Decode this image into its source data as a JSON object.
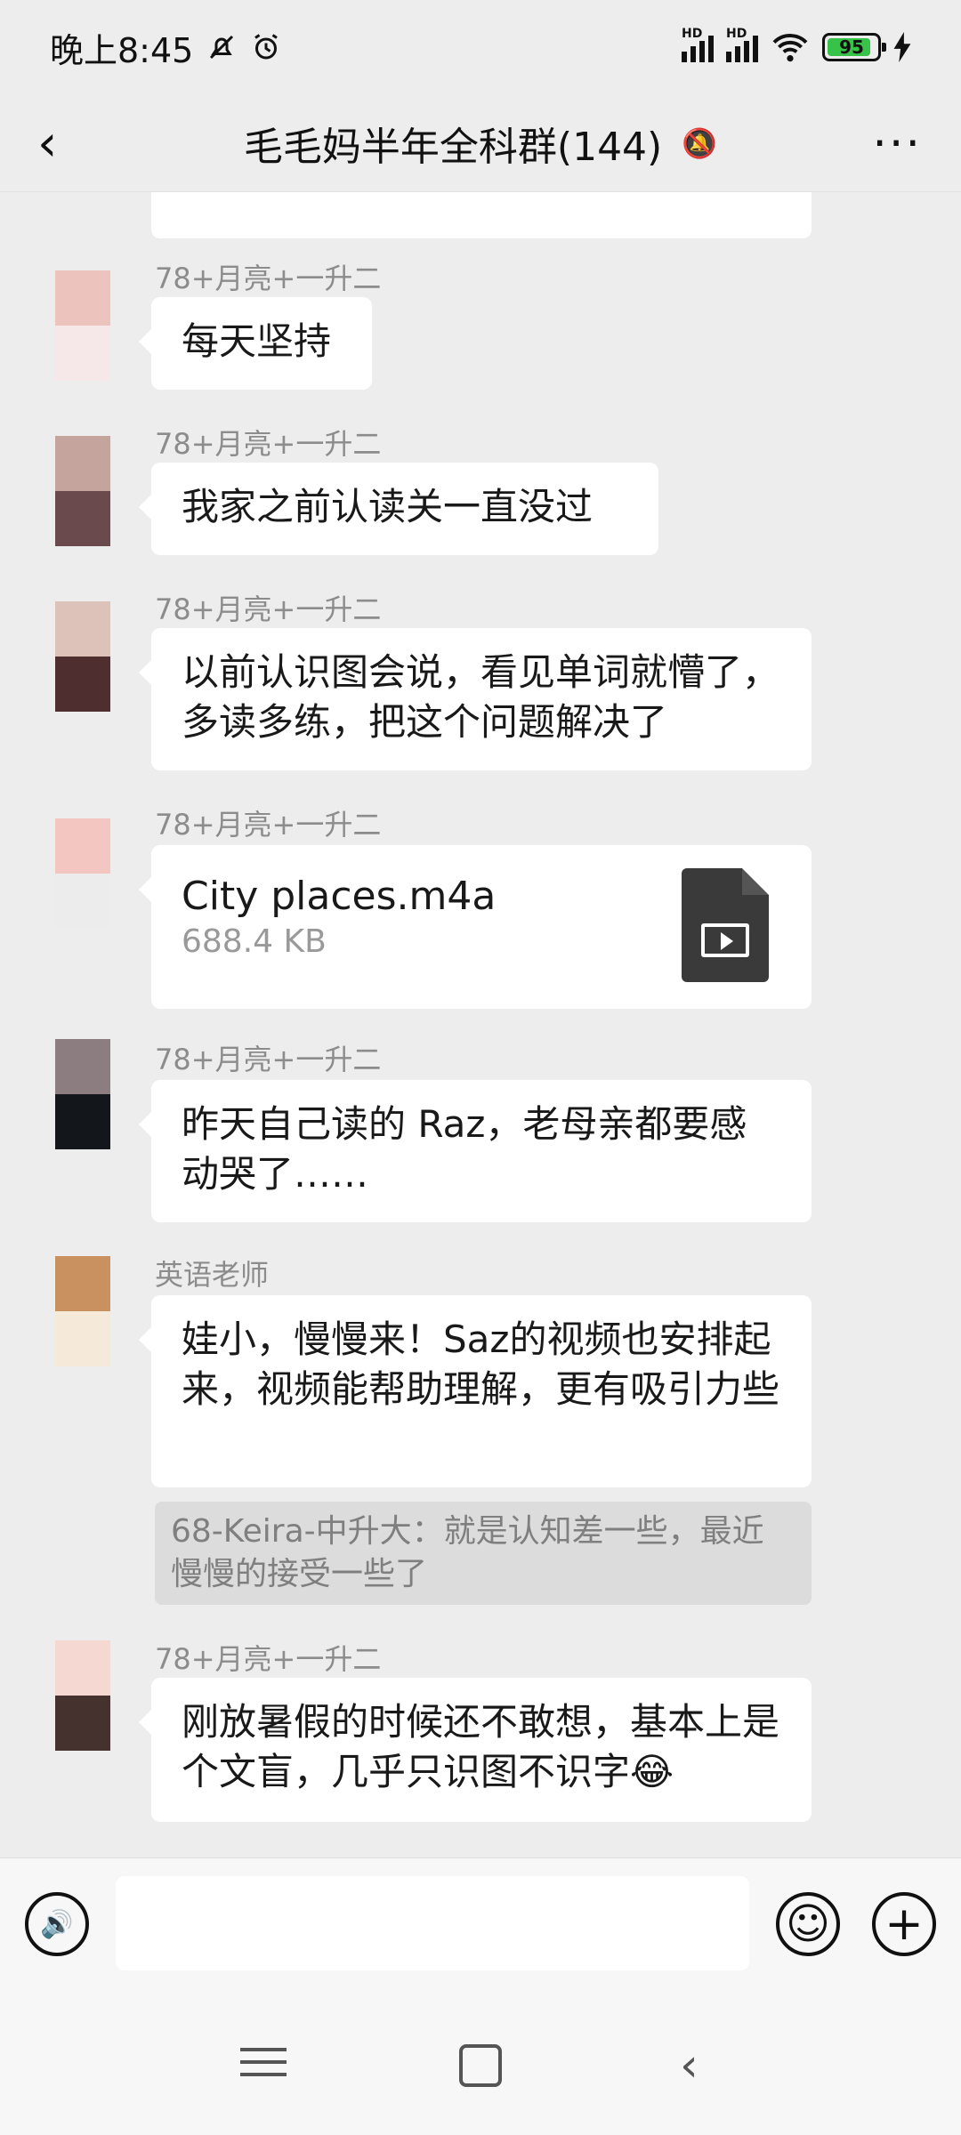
{
  "status_bar": {
    "time": "晚上8:45",
    "icons": [
      "silent-bell-icon",
      "alarm-clock-icon",
      "signal-hd-icon",
      "signal-hd-icon",
      "wifi-icon",
      "battery-icon",
      "charging-icon"
    ],
    "sim1": "HD",
    "sim2": "HD",
    "battery": "95",
    "battery_color": "#37c24a"
  },
  "header": {
    "back_icon": "chevron-left-icon",
    "title": "毛毛妈半年全科群(144)",
    "mute_icon": "muted-bell-icon",
    "more_icon": "more-dots-icon",
    "back_glyph": "‹",
    "mute_glyph": "🔕",
    "more_glyph": "···"
  },
  "messages": [
    {
      "sender": "78+月亮+一升二",
      "text": "每天坚持"
    },
    {
      "sender": "78+月亮+一升二",
      "text": "我家之前认读关一直没过"
    },
    {
      "sender": "78+月亮+一升二",
      "text": "以前认识图会说，看见单词就懵了，多读多练，把这个问题解决了"
    },
    {
      "sender": "78+月亮+一升二",
      "file": {
        "name": "City places.m4a",
        "size": "688.4 KB",
        "icon": "video-file-icon"
      }
    },
    {
      "sender": "78+月亮+一升二",
      "text": "昨天自己读的 Raz，老母亲都要感动哭了……"
    },
    {
      "sender": "英语老师",
      "text": "娃小，慢慢来！Saz的视频也安排起来，视频能帮助理解，更有吸引力些",
      "quote": "68-Keira-中升大：就是认知差一些，最近慢慢的接受一些了"
    },
    {
      "sender": "78+月亮+一升二",
      "text": "刚放暑假的时候还不敢想，基本上是个文盲，几乎只识图不识字😂"
    }
  ],
  "input_bar": {
    "voice_icon": "voice-input-icon",
    "emoji_icon": "emoji-icon",
    "plus_icon": "plus-icon",
    "voice_glyph": "🔊",
    "emoji_glyph": "☺",
    "plus_glyph": "+"
  },
  "nav_bar": {
    "menu_icon": "menu-icon",
    "home_icon": "home-icon",
    "back_icon": "back-icon",
    "back_glyph": "‹"
  },
  "colors": {
    "background": "#ededed",
    "bubble": "#ffffff",
    "quote_bg": "#dcdcdc",
    "sender_text": "#8c8c8c"
  }
}
